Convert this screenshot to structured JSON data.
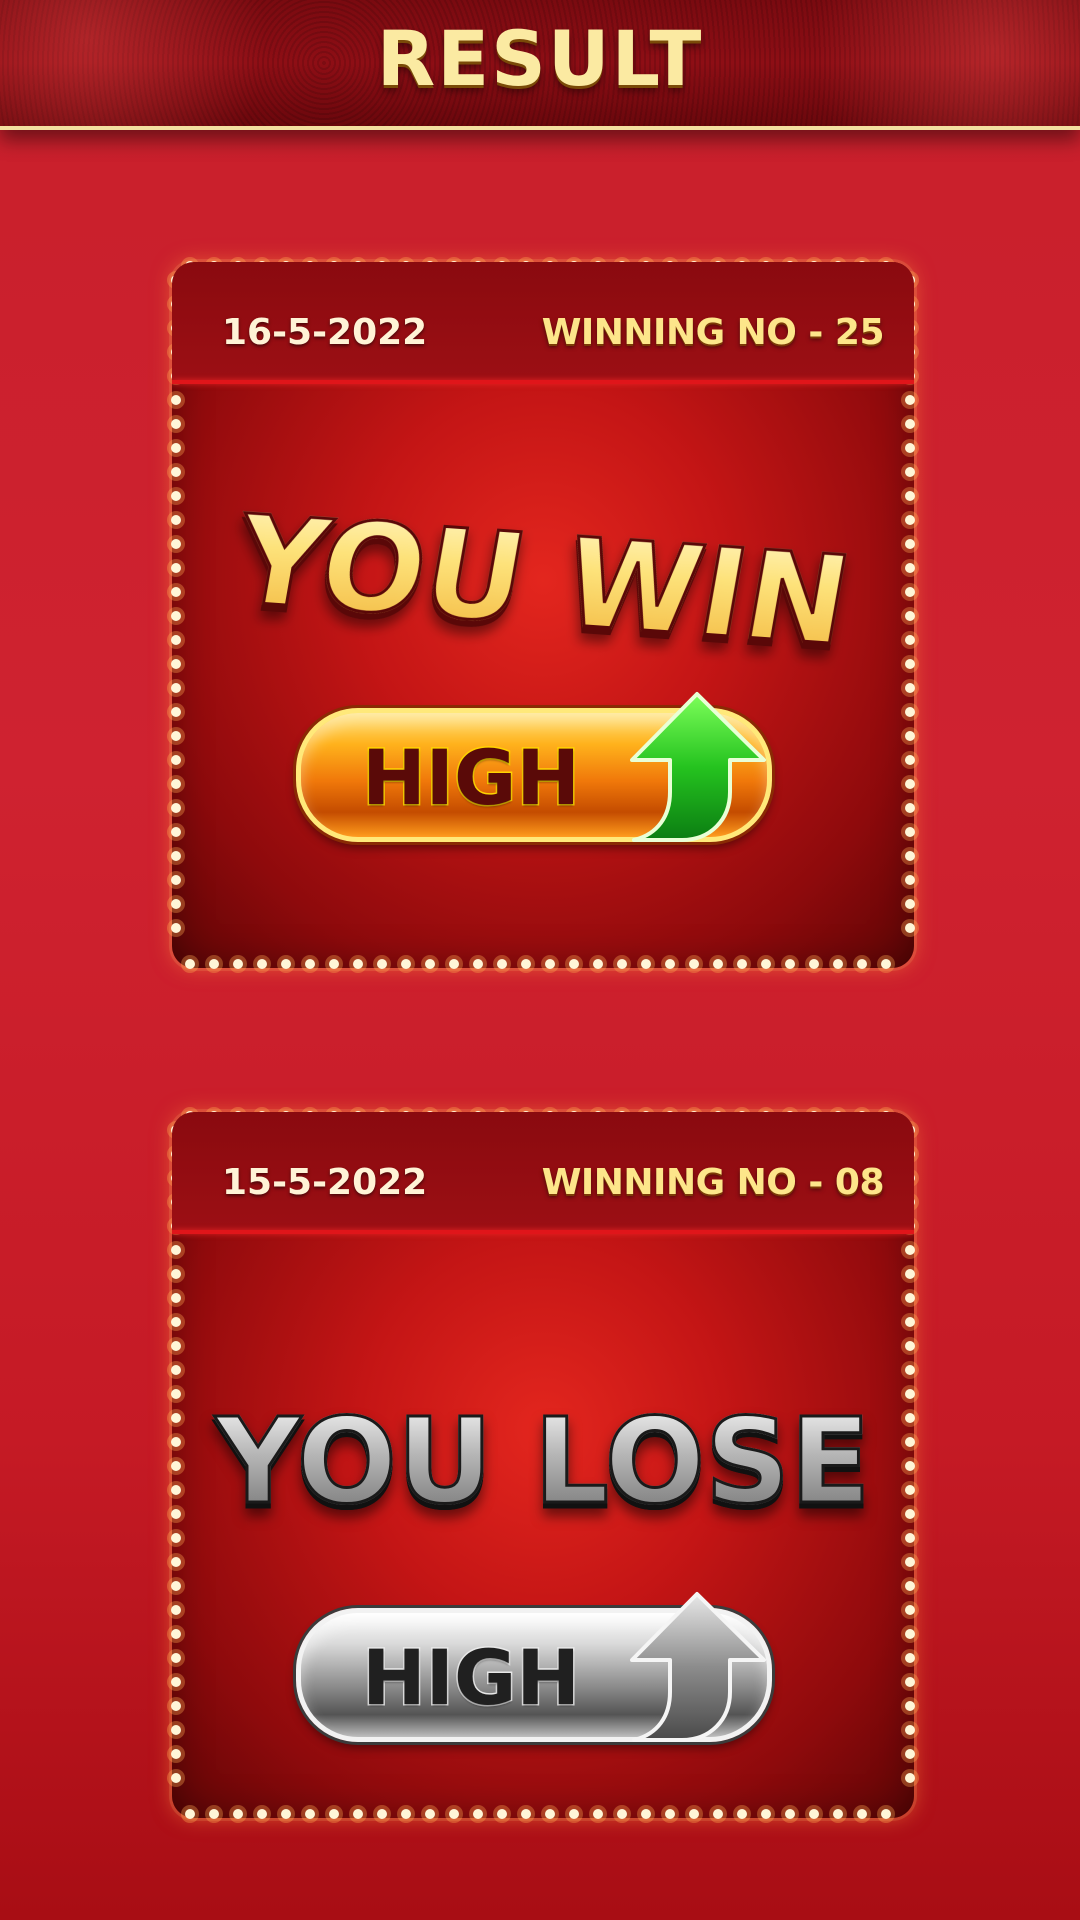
{
  "header": {
    "title": "RESULT"
  },
  "results": [
    {
      "date": "16-5-2022",
      "winning_no": "WINNING NO - 25",
      "outcome": "YOU WIN",
      "bet": "HIGH",
      "bet_direction": "up-arrow-icon",
      "theme_color": "#ffb21c",
      "arrow_color": "#1fb31f"
    },
    {
      "date": "15-5-2022",
      "winning_no": "WINNING NO - 08",
      "outcome": "YOU LOSE",
      "bet": "HIGH",
      "bet_direction": "up-arrow-icon",
      "theme_color": "#8a8a8a",
      "arrow_color": "#6a6a6a"
    }
  ],
  "colors": {
    "background": "#cf2230",
    "header_bg": "#8e0e15",
    "accent_gold": "#fde68a",
    "marquee_light": "#fff6d8"
  }
}
